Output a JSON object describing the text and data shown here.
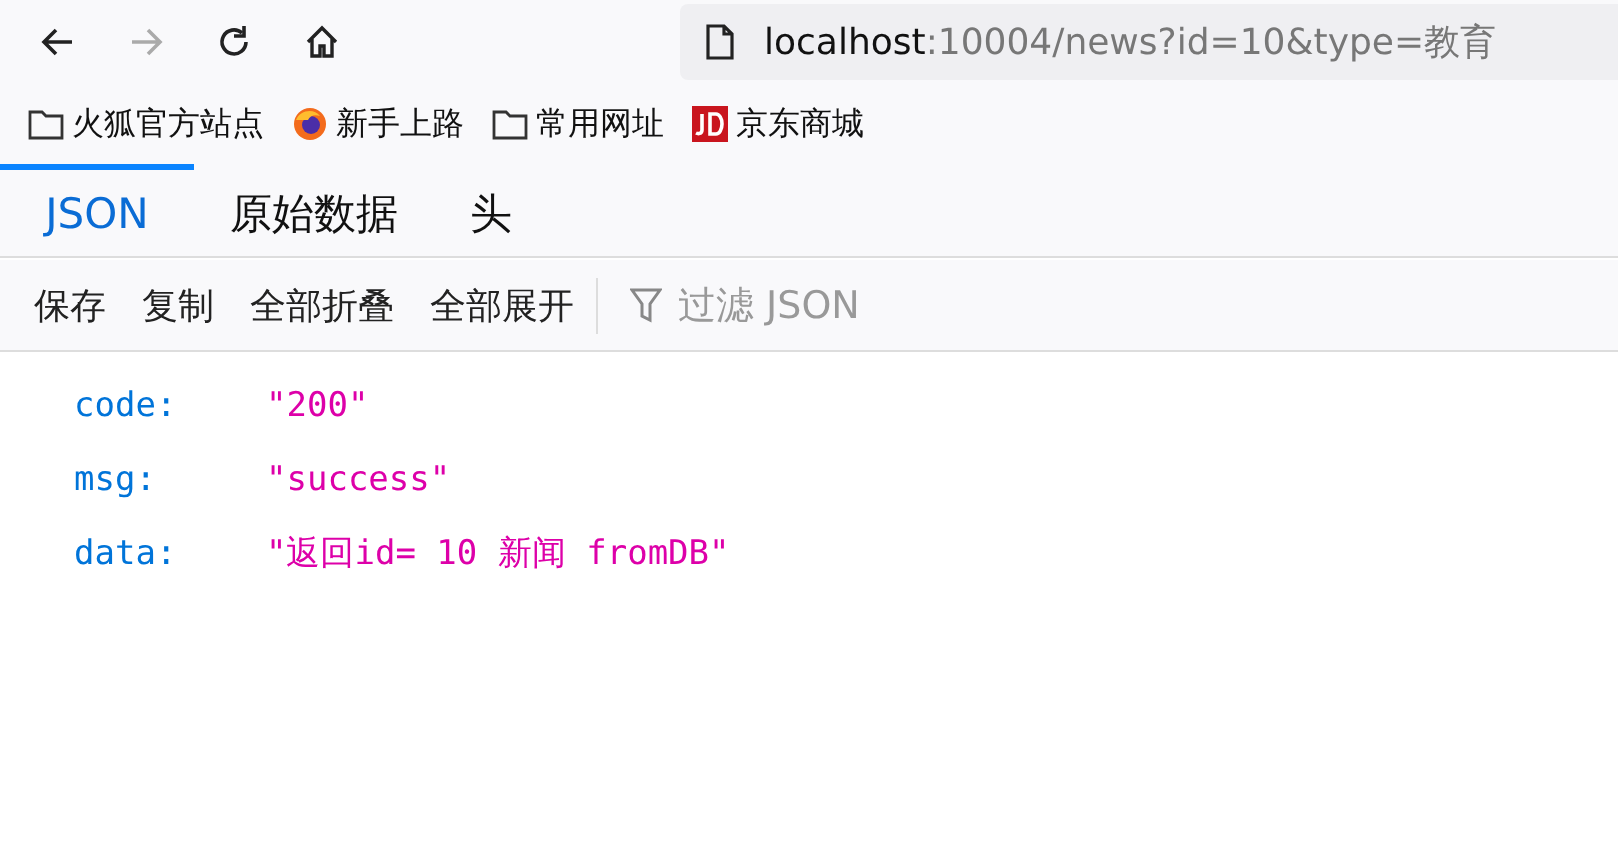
{
  "toolbar": {
    "nav_buttons": [
      {
        "kind": "back",
        "disabled": false
      },
      {
        "kind": "forward",
        "disabled": true
      },
      {
        "kind": "reload",
        "disabled": false
      },
      {
        "kind": "home",
        "disabled": false
      }
    ],
    "address": {
      "host": "localhost",
      "rest": ":10004/news?id=10&type=教育"
    }
  },
  "bookmarks": [
    {
      "kind": "folder",
      "label": "火狐官方站点"
    },
    {
      "kind": "firefox",
      "label": "新手上路"
    },
    {
      "kind": "folder",
      "label": "常用网址"
    },
    {
      "kind": "jd",
      "label": "京东商城"
    }
  ],
  "tabs": [
    {
      "label": "JSON",
      "selected": true
    },
    {
      "label": "原始数据",
      "selected": false
    },
    {
      "label": "头",
      "selected": false
    }
  ],
  "actions": [
    "保存",
    "复制",
    "全部折叠",
    "全部展开"
  ],
  "filter": {
    "placeholder": "过滤 JSON"
  },
  "json_rows": [
    {
      "key": "code:",
      "value": "\"200\""
    },
    {
      "key": "msg:",
      "value": "\"success\""
    },
    {
      "key": "data:",
      "value": "\"返回id= 10 新闻 fromDB\""
    }
  ]
}
